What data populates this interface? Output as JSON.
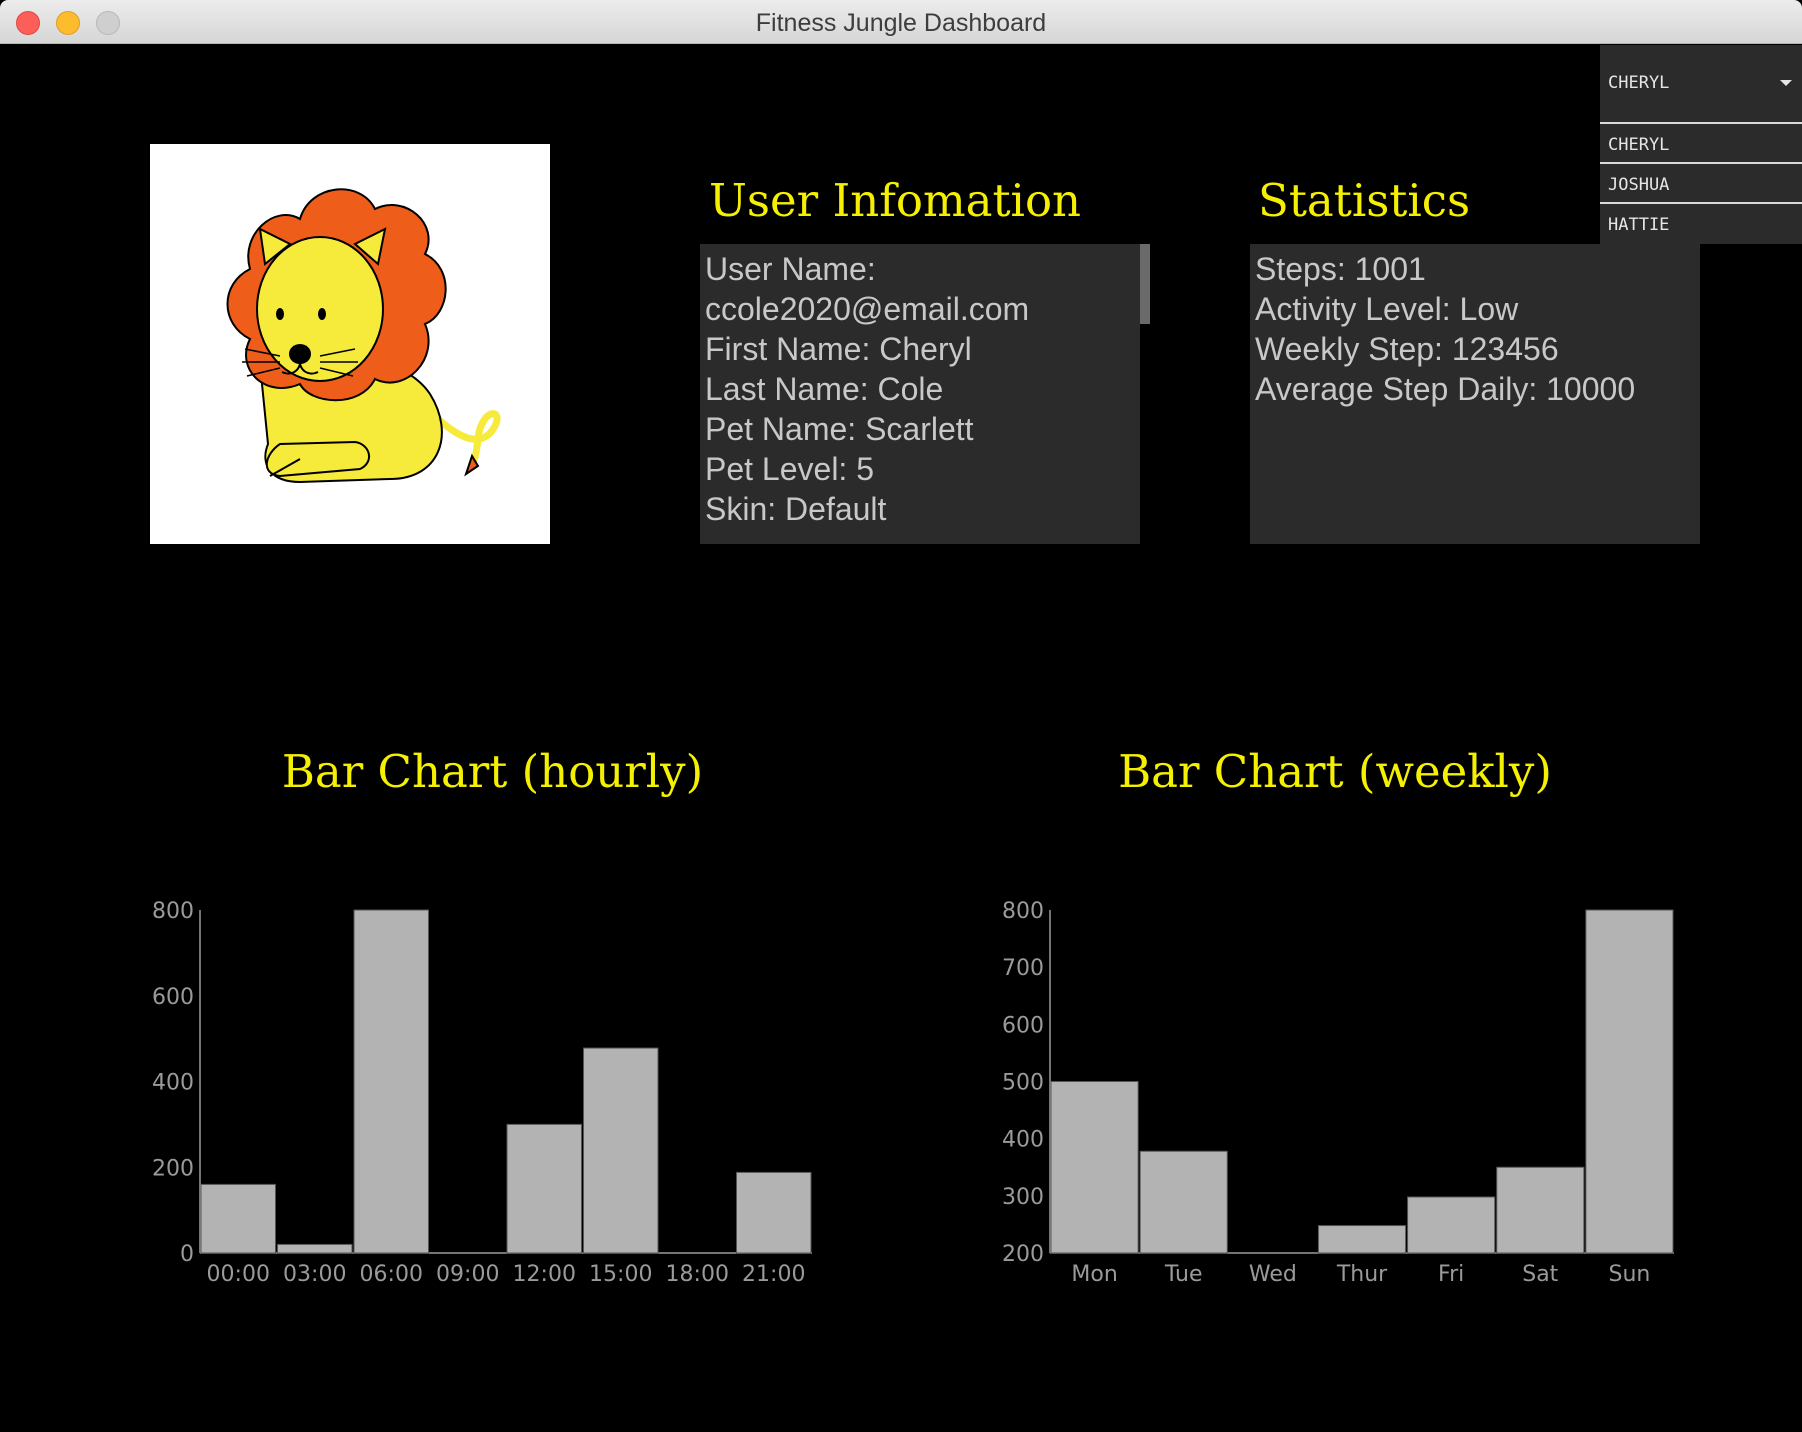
{
  "window": {
    "title": "Fitness Jungle Dashboard"
  },
  "user_select": {
    "selected": "CHERYL",
    "options": [
      "CHERYL",
      "JOSHUA",
      "HATTIE"
    ]
  },
  "avatar": {
    "alt": "lion pet avatar"
  },
  "user_info": {
    "heading": "User Infomation",
    "lines": [
      "User Name:",
      "ccole2020@email.com",
      "First Name: Cheryl",
      "Last Name: Cole",
      "Pet Name: Scarlett",
      "Pet Level: 5",
      "Skin: Default"
    ]
  },
  "statistics": {
    "heading": "Statistics",
    "lines": [
      "Steps: 1001",
      "Activity Level: Low",
      "Weekly Step: 123456",
      "Average Step Daily: 10000"
    ]
  },
  "hourly_chart": {
    "title": "Bar Chart (hourly)"
  },
  "weekly_chart": {
    "title": "Bar Chart (weekly)"
  },
  "chart_data": [
    {
      "type": "bar",
      "title": "Bar Chart (hourly)",
      "categories": [
        "00:00",
        "03:00",
        "06:00",
        "09:00",
        "12:00",
        "15:00",
        "18:00",
        "21:00"
      ],
      "values": [
        160,
        20,
        800,
        0,
        300,
        478,
        0,
        188
      ],
      "ylim": [
        0,
        800
      ],
      "yticks": [
        0,
        200,
        400,
        600,
        800
      ],
      "grid": false,
      "colors": {
        "bar": "#b3b3b3",
        "axis": "#9a9a9a"
      }
    },
    {
      "type": "bar",
      "title": "Bar Chart (weekly)",
      "categories": [
        "Mon",
        "Tue",
        "Wed",
        "Thur",
        "Fri",
        "Sat",
        "Sun"
      ],
      "values": [
        500,
        378,
        200,
        248,
        298,
        350,
        800
      ],
      "ylim": [
        200,
        800
      ],
      "yticks": [
        200,
        300,
        400,
        500,
        600,
        700,
        800
      ],
      "grid": false,
      "colors": {
        "bar": "#b3b3b3",
        "axis": "#9a9a9a"
      }
    }
  ]
}
